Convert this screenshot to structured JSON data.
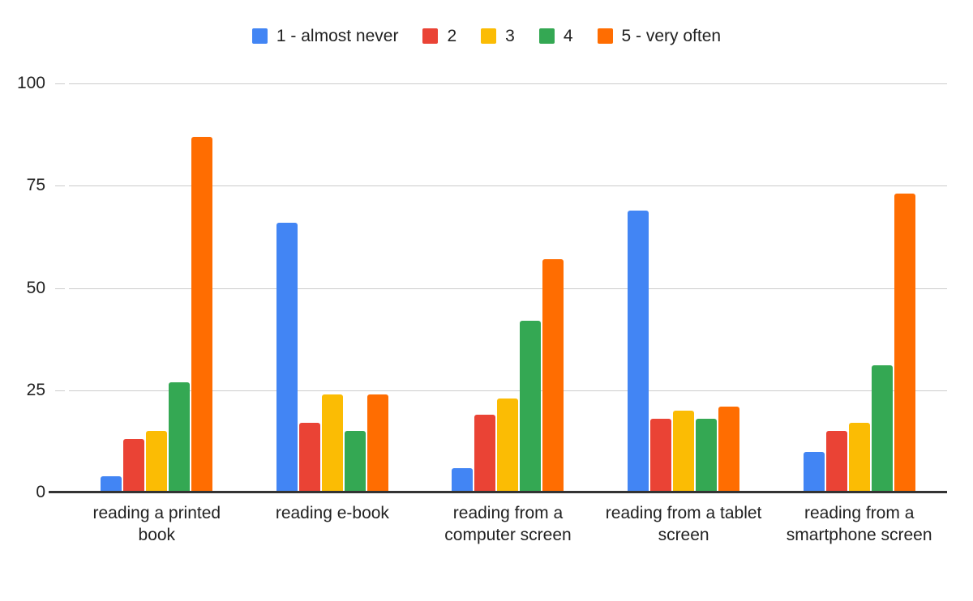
{
  "chart_data": {
    "type": "bar",
    "title": "",
    "subtitle": "",
    "xlabel": "",
    "ylabel": "",
    "ylim": [
      0,
      100
    ],
    "yticks": [
      "0",
      "25",
      "50",
      "75",
      "100"
    ],
    "ytick_values": [
      0,
      25,
      50,
      75,
      100
    ],
    "grid": true,
    "legend_position": "top-center",
    "categories": [
      "reading a printed book",
      "reading e-book",
      "reading from a computer screen",
      "reading from a tablet screen",
      "reading from a smartphone screen"
    ],
    "series": [
      {
        "name": "1 - almost never",
        "color": "#4285F4",
        "values": [
          4,
          66,
          6,
          69,
          10
        ]
      },
      {
        "name": "2",
        "color": "#EA4335",
        "values": [
          13,
          17,
          19,
          18,
          15
        ]
      },
      {
        "name": "3",
        "color": "#FBBC04",
        "values": [
          15,
          24,
          23,
          20,
          17
        ]
      },
      {
        "name": "4",
        "color": "#34A853",
        "values": [
          27,
          15,
          42,
          18,
          31
        ]
      },
      {
        "name": "5 - very often",
        "color": "#FF6D01",
        "values": [
          87,
          24,
          57,
          21,
          73
        ]
      }
    ]
  },
  "axis": {
    "baseline_color": "#333333",
    "gridline_color": "#cccccc",
    "tick_text_color": "#222222"
  }
}
